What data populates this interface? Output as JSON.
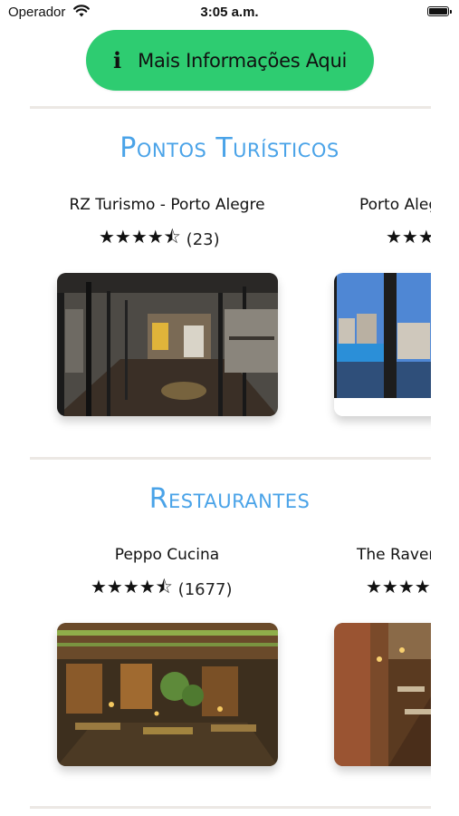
{
  "status_bar": {
    "carrier": "Operador",
    "time": "3:05 a.m."
  },
  "info_button": {
    "icon": "i",
    "label": "Mais Informações Aqui"
  },
  "sections": [
    {
      "title": "Pontos Turísticos",
      "cards": [
        {
          "name": "RZ Turismo - Porto Alegre",
          "stars": "★★★★⯪",
          "count": "(23)"
        },
        {
          "name": "Porto Alegre",
          "stars": "★★★★⯪",
          "count": ""
        }
      ]
    },
    {
      "title": "Restaurantes",
      "cards": [
        {
          "name": "Peppo Cucina",
          "stars": "★★★★⯪",
          "count": "(1677)"
        },
        {
          "name": "The Raven",
          "stars": "★★★★⯪",
          "count": ""
        }
      ]
    }
  ]
}
